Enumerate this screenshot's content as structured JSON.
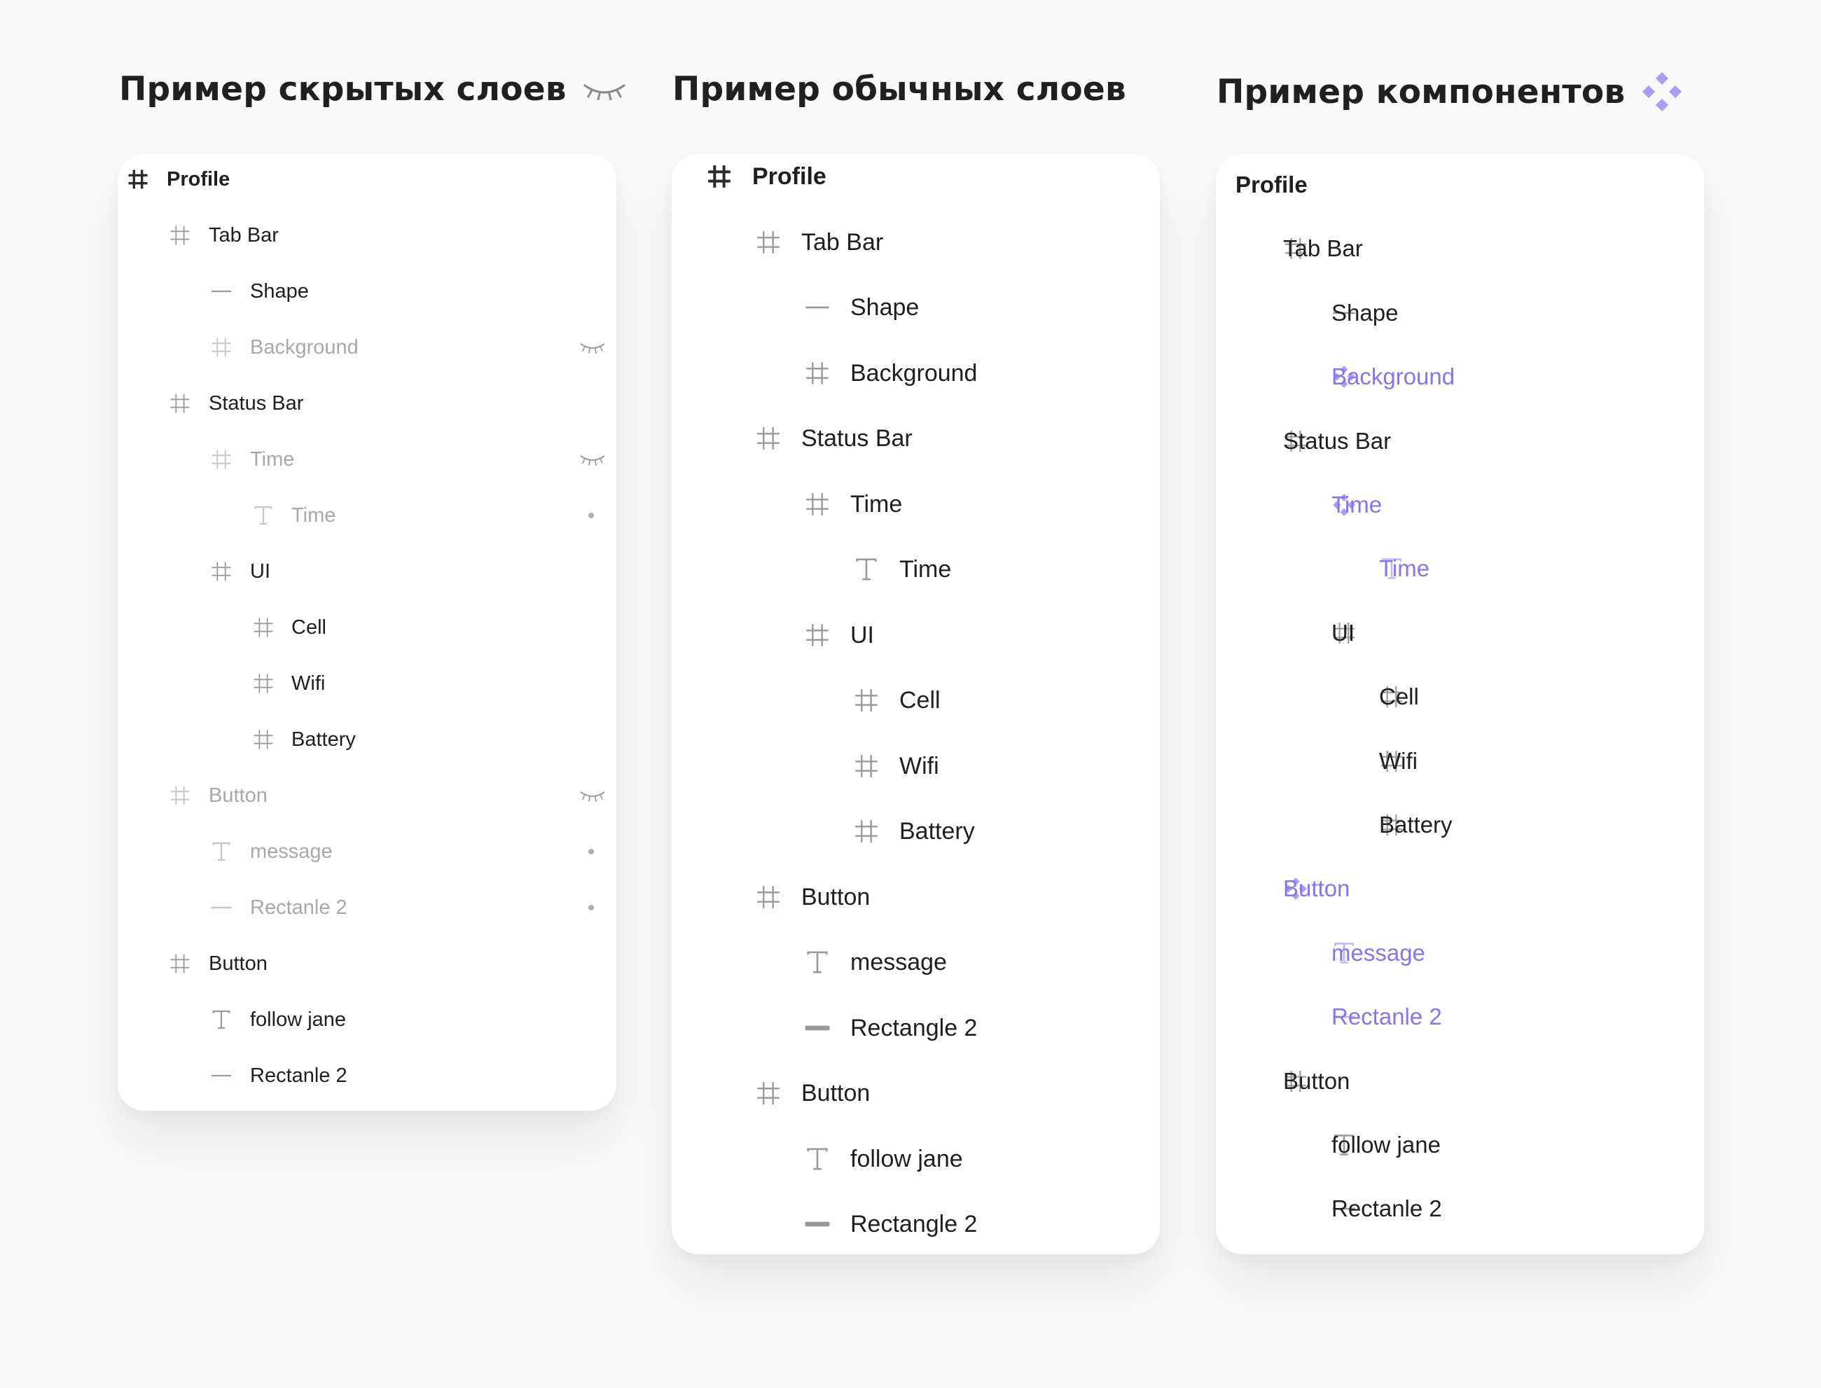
{
  "colors": {
    "text": "#1f1f1f",
    "muted": "#a8a8a8",
    "purple": "#8a72f4",
    "icon": "#9a9a9a",
    "page_bg": "#f9f9f9"
  },
  "columns": [
    {
      "title": "Пример скрытых слоев",
      "title_icon": "closed-eye-icon",
      "layers": [
        {
          "label": "Profile",
          "icon": "frame-icon",
          "level": 0,
          "bold": true
        },
        {
          "label": "Tab Bar",
          "icon": "frame-icon",
          "level": 1
        },
        {
          "label": "Shape",
          "icon": "line-icon",
          "level": 2
        },
        {
          "label": "Background",
          "icon": "frame-icon",
          "level": 2,
          "state": "hidden"
        },
        {
          "label": "Status Bar",
          "icon": "frame-icon",
          "level": 1
        },
        {
          "label": "Time",
          "icon": "frame-icon",
          "level": 2,
          "state": "hidden"
        },
        {
          "label": "Time",
          "icon": "text-icon",
          "level": 3,
          "state": "hidden-child"
        },
        {
          "label": "UI",
          "icon": "frame-icon",
          "level": 2
        },
        {
          "label": "Cell",
          "icon": "frame-icon",
          "level": 3
        },
        {
          "label": "Wifi",
          "icon": "frame-icon",
          "level": 3
        },
        {
          "label": "Battery",
          "icon": "frame-icon",
          "level": 3
        },
        {
          "label": "Button",
          "icon": "frame-icon",
          "level": 1,
          "state": "hidden"
        },
        {
          "label": "message",
          "icon": "text-icon",
          "level": 2,
          "state": "hidden-child"
        },
        {
          "label": "Rectanle 2",
          "icon": "line-icon",
          "level": 2,
          "state": "hidden-child"
        },
        {
          "label": "Button",
          "icon": "frame-icon",
          "level": 1
        },
        {
          "label": "follow jane",
          "icon": "text-icon",
          "level": 2
        },
        {
          "label": "Rectanle 2",
          "icon": "line-icon",
          "level": 2
        }
      ]
    },
    {
      "title": "Пример обычных слоев",
      "title_icon": "",
      "layers": [
        {
          "label": "Profile",
          "icon": "frame-icon",
          "level": 0,
          "bold": true
        },
        {
          "label": "Tab Bar",
          "icon": "frame-icon",
          "level": 1
        },
        {
          "label": "Shape",
          "icon": "line-icon",
          "level": 2
        },
        {
          "label": "Background",
          "icon": "frame-icon",
          "level": 2
        },
        {
          "label": "Status Bar",
          "icon": "frame-icon",
          "level": 1
        },
        {
          "label": "Time",
          "icon": "frame-icon",
          "level": 2
        },
        {
          "label": "Time",
          "icon": "text-icon",
          "level": 3
        },
        {
          "label": "UI",
          "icon": "frame-icon",
          "level": 2
        },
        {
          "label": "Cell",
          "icon": "frame-icon",
          "level": 3
        },
        {
          "label": "Wifi",
          "icon": "frame-icon",
          "level": 3
        },
        {
          "label": "Battery",
          "icon": "frame-icon",
          "level": 3
        },
        {
          "label": "Button",
          "icon": "frame-icon",
          "level": 1
        },
        {
          "label": "message",
          "icon": "text-icon",
          "level": 2
        },
        {
          "label": "Rectangle 2",
          "icon": "rect-icon",
          "level": 2
        },
        {
          "label": "Button",
          "icon": "frame-icon",
          "level": 1
        },
        {
          "label": "follow jane",
          "icon": "text-icon",
          "level": 2
        },
        {
          "label": "Rectangle 2",
          "icon": "rect-icon",
          "level": 2
        }
      ]
    },
    {
      "title": "Пример компонентов",
      "title_icon": "component-icon",
      "layers": [
        {
          "label": "Profile",
          "icon": "",
          "level": 0,
          "bold": true
        },
        {
          "label": "Tab Bar",
          "icon": "frame-icon",
          "level": 1
        },
        {
          "label": "Shape",
          "icon": "line-icon",
          "level": 2
        },
        {
          "label": "Background",
          "icon": "component-icon",
          "level": 2,
          "state": "component"
        },
        {
          "label": "Status Bar",
          "icon": "frame-icon",
          "level": 1
        },
        {
          "label": "Time",
          "icon": "component-icon",
          "level": 2,
          "state": "component"
        },
        {
          "label": "Time",
          "icon": "text-icon",
          "level": 3,
          "state": "component"
        },
        {
          "label": "UI",
          "icon": "frame-icon",
          "level": 2
        },
        {
          "label": "Cell",
          "icon": "frame-icon",
          "level": 3
        },
        {
          "label": "Wifi",
          "icon": "frame-icon",
          "level": 3
        },
        {
          "label": "Battery",
          "icon": "frame-icon",
          "level": 3
        },
        {
          "label": "Button",
          "icon": "component-icon",
          "level": 1,
          "state": "component"
        },
        {
          "label": "message",
          "icon": "text-icon",
          "level": 2,
          "state": "component"
        },
        {
          "label": "Rectanle 2",
          "icon": "line-icon",
          "level": 2,
          "state": "component"
        },
        {
          "label": "Button",
          "icon": "frame-icon",
          "level": 1
        },
        {
          "label": "follow jane",
          "icon": "text-icon",
          "level": 2
        },
        {
          "label": "Rectanle 2",
          "icon": "line-icon",
          "level": 2
        }
      ]
    }
  ]
}
